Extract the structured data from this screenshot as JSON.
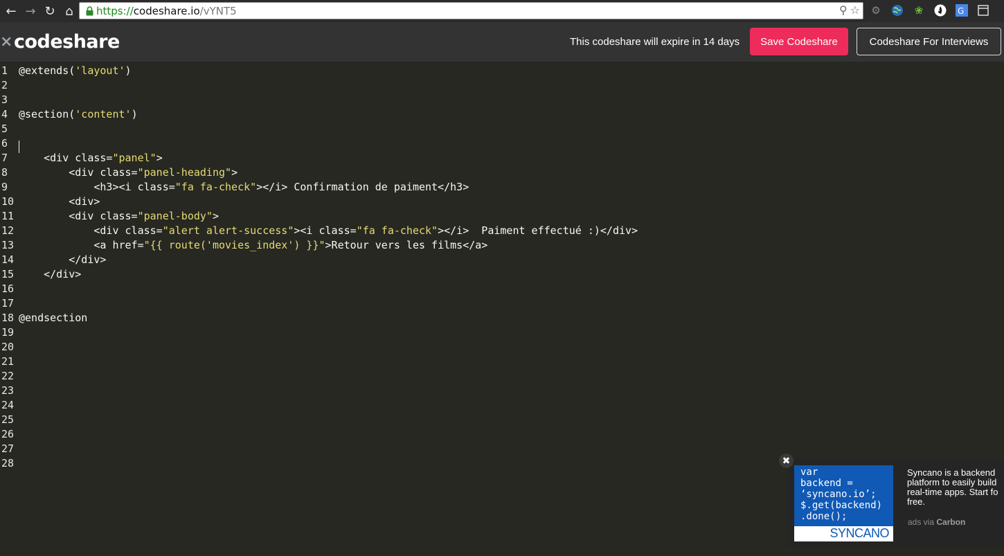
{
  "browser": {
    "url_scheme": "https://",
    "url_domain": "codeshare.io",
    "url_path": "/vYNT5",
    "extensions": [
      "gear-icon",
      "globe-icon",
      "plant-icon",
      "flame-icon",
      "translate-icon",
      "window-icon"
    ]
  },
  "header": {
    "logo_text": "codeshare",
    "expire_text": "This codeshare will expire in 14 days",
    "save_label": "Save Codeshare",
    "interviews_label": "Codeshare For Interviews"
  },
  "colors": {
    "editor_bg": "#272822",
    "header_bg": "#333333",
    "save_button": "#ed2c5b",
    "string": "#e6db74",
    "ad_blue": "#1059b5"
  },
  "editor": {
    "lines": [
      {
        "n": "1",
        "segs": [
          [
            "@extends(",
            ""
          ],
          [
            "'layout'",
            "str"
          ],
          [
            ")",
            ""
          ]
        ]
      },
      {
        "n": "2",
        "segs": []
      },
      {
        "n": "3",
        "segs": []
      },
      {
        "n": "4",
        "segs": [
          [
            "@section(",
            ""
          ],
          [
            "'content'",
            "str"
          ],
          [
            ")",
            ""
          ]
        ]
      },
      {
        "n": "5",
        "segs": []
      },
      {
        "n": "6",
        "segs": []
      },
      {
        "n": "7",
        "segs": [
          [
            "    <div class=",
            ""
          ],
          [
            "\"panel\"",
            "str"
          ],
          [
            ">",
            ""
          ]
        ]
      },
      {
        "n": "8",
        "segs": [
          [
            "        <div class=",
            ""
          ],
          [
            "\"panel-heading\"",
            "str"
          ],
          [
            ">",
            ""
          ]
        ]
      },
      {
        "n": "9",
        "segs": [
          [
            "            <h3><i class=",
            ""
          ],
          [
            "\"fa fa-check\"",
            "str"
          ],
          [
            "></i> Confirmation de paiment</h3>",
            ""
          ]
        ]
      },
      {
        "n": "10",
        "segs": [
          [
            "        <div>",
            ""
          ]
        ]
      },
      {
        "n": "11",
        "segs": [
          [
            "        <div class=",
            ""
          ],
          [
            "\"panel-body\"",
            "str"
          ],
          [
            ">",
            ""
          ]
        ]
      },
      {
        "n": "12",
        "segs": [
          [
            "            <div class=",
            ""
          ],
          [
            "\"alert alert-success\"",
            "str"
          ],
          [
            "><i class=",
            ""
          ],
          [
            "\"fa fa-check\"",
            "str"
          ],
          [
            "></i>  Paiment effectué :)</div>",
            ""
          ]
        ]
      },
      {
        "n": "13",
        "segs": [
          [
            "            <a href=",
            ""
          ],
          [
            "\"{{ route('movies_index') }}\"",
            "str"
          ],
          [
            ">Retour vers les films</a>",
            ""
          ]
        ]
      },
      {
        "n": "14",
        "segs": [
          [
            "        </div>",
            ""
          ]
        ]
      },
      {
        "n": "15",
        "segs": [
          [
            "    </div>",
            ""
          ]
        ]
      },
      {
        "n": "16",
        "segs": []
      },
      {
        "n": "17",
        "segs": []
      },
      {
        "n": "18",
        "segs": [
          [
            "@endsection",
            ""
          ]
        ]
      },
      {
        "n": "19",
        "segs": []
      },
      {
        "n": "20",
        "segs": []
      },
      {
        "n": "21",
        "segs": []
      },
      {
        "n": "22",
        "segs": []
      },
      {
        "n": "23",
        "segs": []
      },
      {
        "n": "24",
        "segs": []
      },
      {
        "n": "25",
        "segs": []
      },
      {
        "n": "26",
        "segs": []
      },
      {
        "n": "27",
        "segs": []
      },
      {
        "n": "28",
        "segs": []
      }
    ]
  },
  "ad": {
    "code_image": "var\nbackend =\n‘syncano.io’;\n$.get(backend)\n.done();",
    "brand": "SYNCANO",
    "text": "Syncano is a backend\nplatform to easily build\nreal-time apps. Start fo\nfree.",
    "via_prefix": "ads via ",
    "via_brand": "Carbon"
  }
}
